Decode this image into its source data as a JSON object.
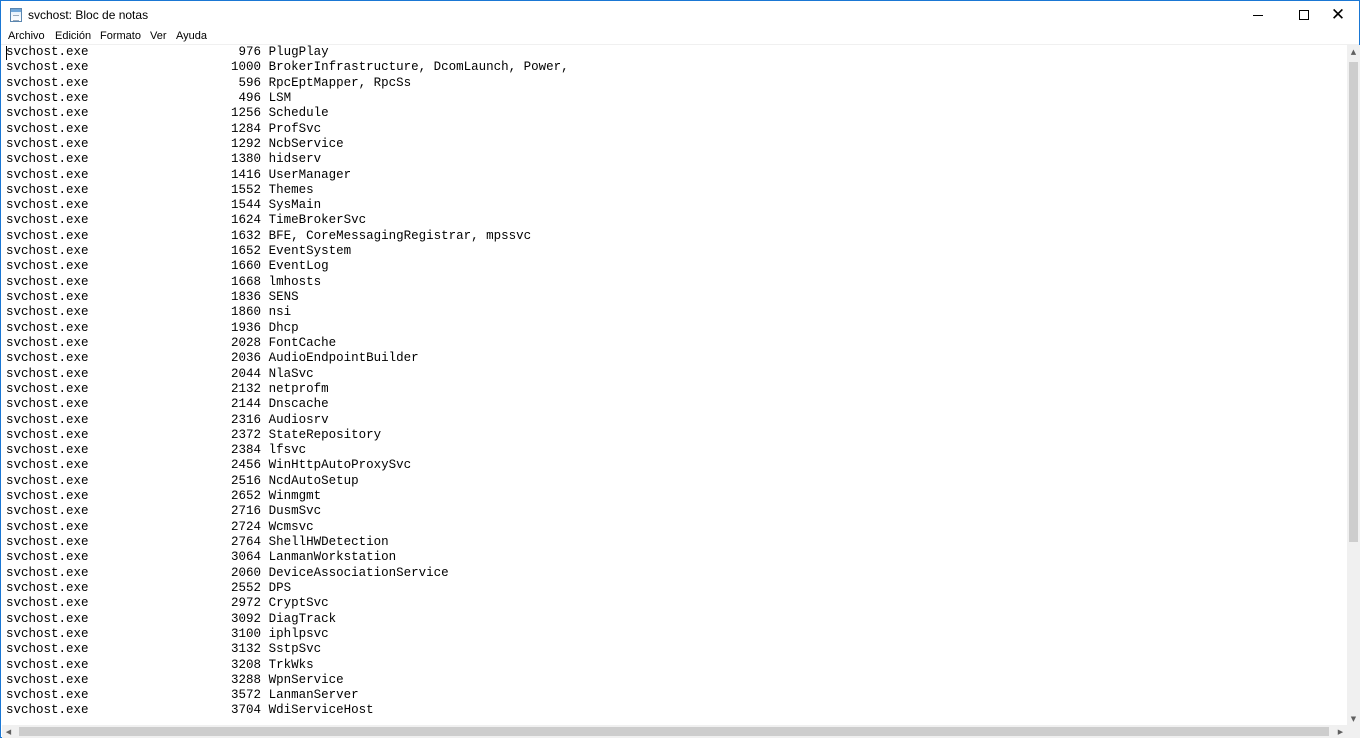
{
  "window": {
    "title": "svchost: Bloc de notas"
  },
  "menu": [
    "Archivo",
    "Edición",
    "Formato",
    "Ver",
    "Ayuda"
  ],
  "document": {
    "lines": [
      [
        "svchost.exe",
        "976",
        "PlugPlay"
      ],
      [
        "svchost.exe",
        "1000",
        "BrokerInfrastructure, DcomLaunch, Power,"
      ],
      [
        "svchost.exe",
        "596",
        "RpcEptMapper, RpcSs"
      ],
      [
        "svchost.exe",
        "496",
        "LSM"
      ],
      [
        "svchost.exe",
        "1256",
        "Schedule"
      ],
      [
        "svchost.exe",
        "1284",
        "ProfSvc"
      ],
      [
        "svchost.exe",
        "1292",
        "NcbService"
      ],
      [
        "svchost.exe",
        "1380",
        "hidserv"
      ],
      [
        "svchost.exe",
        "1416",
        "UserManager"
      ],
      [
        "svchost.exe",
        "1552",
        "Themes"
      ],
      [
        "svchost.exe",
        "1544",
        "SysMain"
      ],
      [
        "svchost.exe",
        "1624",
        "TimeBrokerSvc"
      ],
      [
        "svchost.exe",
        "1632",
        "BFE, CoreMessagingRegistrar, mpssvc"
      ],
      [
        "svchost.exe",
        "1652",
        "EventSystem"
      ],
      [
        "svchost.exe",
        "1660",
        "EventLog"
      ],
      [
        "svchost.exe",
        "1668",
        "lmhosts"
      ],
      [
        "svchost.exe",
        "1836",
        "SENS"
      ],
      [
        "svchost.exe",
        "1860",
        "nsi"
      ],
      [
        "svchost.exe",
        "1936",
        "Dhcp"
      ],
      [
        "svchost.exe",
        "2028",
        "FontCache"
      ],
      [
        "svchost.exe",
        "2036",
        "AudioEndpointBuilder"
      ],
      [
        "svchost.exe",
        "2044",
        "NlaSvc"
      ],
      [
        "svchost.exe",
        "2132",
        "netprofm"
      ],
      [
        "svchost.exe",
        "2144",
        "Dnscache"
      ],
      [
        "svchost.exe",
        "2316",
        "Audiosrv"
      ],
      [
        "svchost.exe",
        "2372",
        "StateRepository"
      ],
      [
        "svchost.exe",
        "2384",
        "lfsvc"
      ],
      [
        "svchost.exe",
        "2456",
        "WinHttpAutoProxySvc"
      ],
      [
        "svchost.exe",
        "2516",
        "NcdAutoSetup"
      ],
      [
        "svchost.exe",
        "2652",
        "Winmgmt"
      ],
      [
        "svchost.exe",
        "2716",
        "DusmSvc"
      ],
      [
        "svchost.exe",
        "2724",
        "Wcmsvc"
      ],
      [
        "svchost.exe",
        "2764",
        "ShellHWDetection"
      ],
      [
        "svchost.exe",
        "3064",
        "LanmanWorkstation"
      ],
      [
        "svchost.exe",
        "2060",
        "DeviceAssociationService"
      ],
      [
        "svchost.exe",
        "2552",
        "DPS"
      ],
      [
        "svchost.exe",
        "2972",
        "CryptSvc"
      ],
      [
        "svchost.exe",
        "3092",
        "DiagTrack"
      ],
      [
        "svchost.exe",
        "3100",
        "iphlpsvc"
      ],
      [
        "svchost.exe",
        "3132",
        "SstpSvc"
      ],
      [
        "svchost.exe",
        "3208",
        "TrkWks"
      ],
      [
        "svchost.exe",
        "3288",
        "WpnService"
      ],
      [
        "svchost.exe",
        "3572",
        "LanmanServer"
      ],
      [
        "svchost.exe",
        "3704",
        "WdiServiceHost"
      ]
    ]
  },
  "icons": {
    "app": "notepad-icon",
    "minimize": "minimize-icon",
    "maximize": "maximize-icon",
    "close": "close-icon"
  }
}
